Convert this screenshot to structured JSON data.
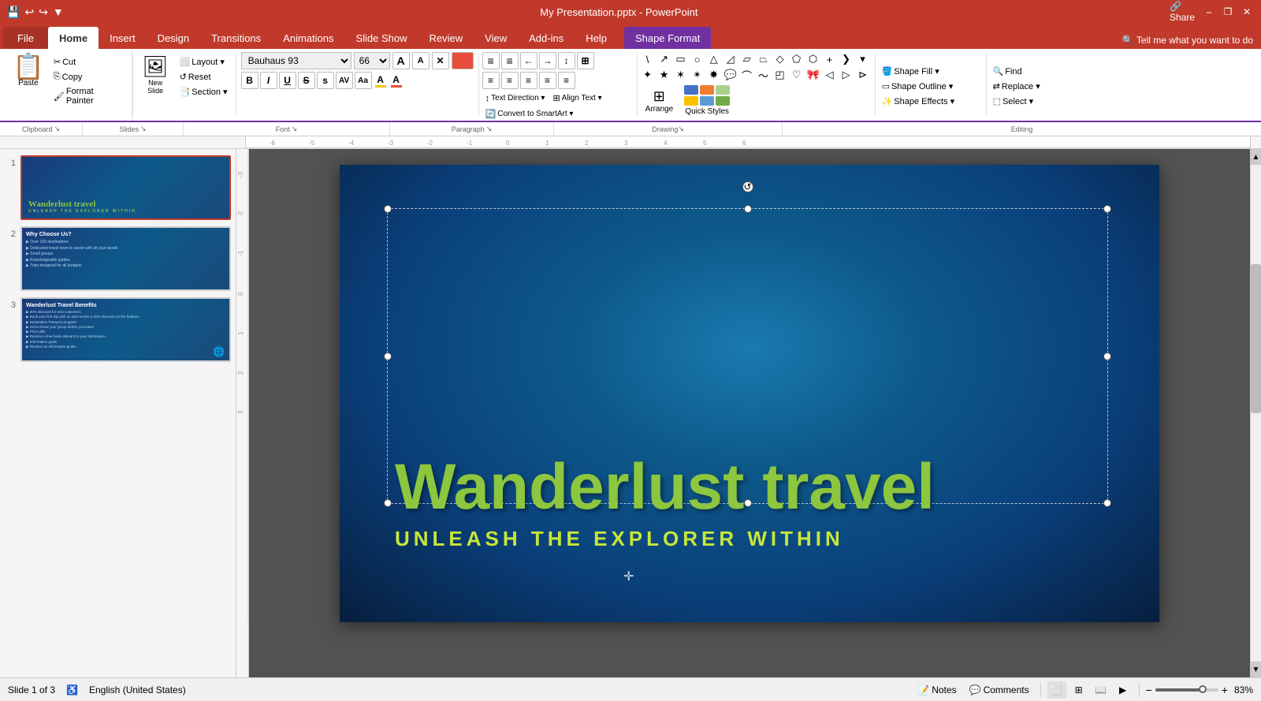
{
  "titleBar": {
    "title": "My Presentation.pptx - PowerPoint",
    "quickAccess": [
      "💾",
      "↩",
      "↪",
      "⬛"
    ],
    "winControls": [
      "⎯",
      "❐",
      "✕"
    ]
  },
  "tabs": [
    {
      "id": "file",
      "label": "File",
      "active": false
    },
    {
      "id": "home",
      "label": "Home",
      "active": true
    },
    {
      "id": "insert",
      "label": "Insert",
      "active": false
    },
    {
      "id": "design",
      "label": "Design",
      "active": false
    },
    {
      "id": "transitions",
      "label": "Transitions",
      "active": false
    },
    {
      "id": "animations",
      "label": "Animations",
      "active": false
    },
    {
      "id": "slideshow",
      "label": "Slide Show",
      "active": false
    },
    {
      "id": "review",
      "label": "Review",
      "active": false
    },
    {
      "id": "view",
      "label": "View",
      "active": false
    },
    {
      "id": "addins",
      "label": "Add-ins",
      "active": false
    },
    {
      "id": "help",
      "label": "Help",
      "active": false
    },
    {
      "id": "shapeformat",
      "label": "Shape Format",
      "active": false
    }
  ],
  "ribbon": {
    "clipboard": {
      "label": "Clipboard",
      "paste": "Paste",
      "cut": "Cut",
      "copy": "Copy",
      "formatPainter": "Format Painter"
    },
    "slides": {
      "label": "Slides",
      "newSlide": "New\nSlide",
      "layout": "Layout",
      "reset": "Reset",
      "section": "Section"
    },
    "font": {
      "label": "Font",
      "fontName": "Bauhaus 93",
      "fontSize": "66",
      "bold": "B",
      "italic": "I",
      "underline": "U",
      "strikethrough": "S",
      "shadow": "s",
      "charSpacing": "AV",
      "changeCaps": "Aa",
      "fontColor": "A",
      "highlight": "A"
    },
    "paragraph": {
      "label": "Paragraph",
      "bullets": "≡",
      "numbering": "≡",
      "decreaseIndent": "←",
      "increaseIndent": "→",
      "lineSpacing": "≡",
      "columns": "⊞",
      "textDirection": "Text Direction",
      "alignText": "Align Text",
      "convertSmartArt": "Convert to SmartArt"
    },
    "drawing": {
      "label": "Drawing",
      "arrange": "Arrange",
      "quickStyles": "Quick Styles",
      "shapeFill": "Shape Fill",
      "shapeOutline": "Shape Outline",
      "shapeEffects": "Shape Effects"
    },
    "editing": {
      "label": "Editing",
      "find": "Find",
      "replace": "Replace",
      "select": "Select"
    }
  },
  "slides": [
    {
      "num": "1",
      "title": "Wanderlust travel",
      "subtitle": "UNLEASH THE EXPLORER WITHIN",
      "active": true
    },
    {
      "num": "2",
      "title": "Why Choose Us?",
      "bullets": [
        "Over 150 destinations",
        "Dedicated travel team to assist with all your needs",
        "Small groups",
        "Knowledgeable guides",
        "Trips designed for all budgets"
      ]
    },
    {
      "num": "3",
      "title": "Wanderlust Travel Benefits",
      "bullets": [
        "30% discount for new customers",
        "Book your first trip with us and receive a 20% discount on the balance",
        "Destination Passport program",
        "Get to know your group before you leave",
        "Prize gifts",
        "Receive a free book relevant to your destination to get you in the mood",
        "Information goals",
        "Receive an informative guide with packing tips and destination information"
      ]
    }
  ],
  "canvas": {
    "mainTitle": "Wanderlust travel",
    "subtitle": "UNLEASH THE EXPLORER WITHIN"
  },
  "statusBar": {
    "slideInfo": "Slide 1 of 3",
    "language": "English (United States)",
    "notes": "Notes",
    "comments": "Comments",
    "zoom": "83%"
  }
}
